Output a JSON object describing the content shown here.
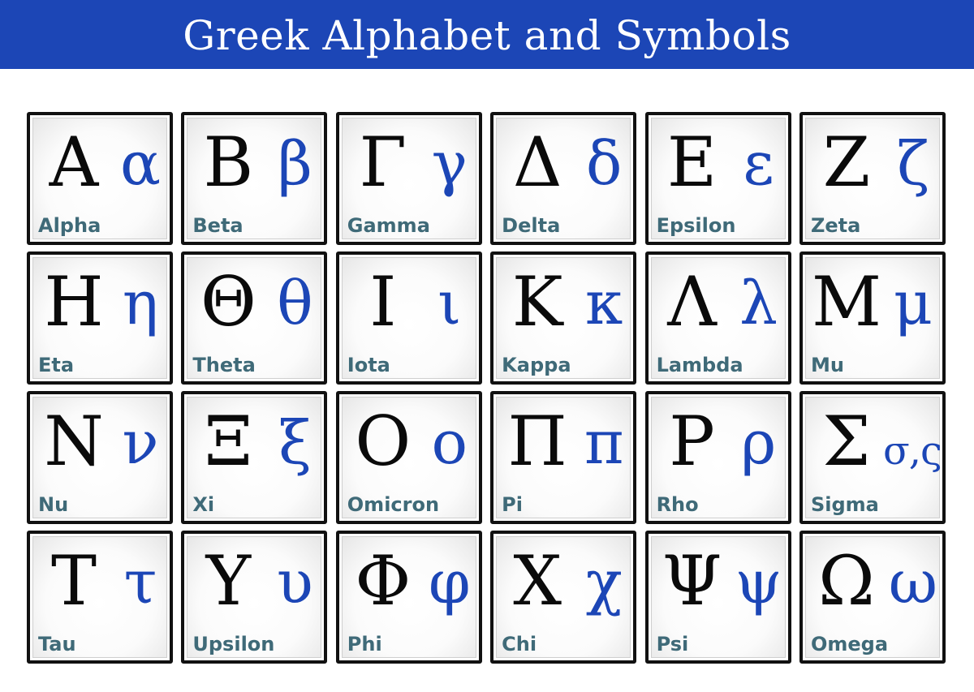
{
  "title": "Greek Alphabet and Symbols",
  "letters": [
    {
      "upper": "Α",
      "lower": "α",
      "name": "Alpha"
    },
    {
      "upper": "Β",
      "lower": "β",
      "name": "Beta"
    },
    {
      "upper": "Γ",
      "lower": "γ",
      "name": "Gamma"
    },
    {
      "upper": "Δ",
      "lower": "δ",
      "name": "Delta"
    },
    {
      "upper": "Ε",
      "lower": "ε",
      "name": "Epsilon"
    },
    {
      "upper": "Ζ",
      "lower": "ζ",
      "name": "Zeta"
    },
    {
      "upper": "Η",
      "lower": "η",
      "name": "Eta"
    },
    {
      "upper": "Θ",
      "lower": "θ",
      "name": "Theta"
    },
    {
      "upper": "Ι",
      "lower": "ι",
      "name": "Iota"
    },
    {
      "upper": "Κ",
      "lower": "κ",
      "name": "Kappa"
    },
    {
      "upper": "Λ",
      "lower": "λ",
      "name": "Lambda"
    },
    {
      "upper": "Μ",
      "lower": "μ",
      "name": "Mu"
    },
    {
      "upper": "Ν",
      "lower": "ν",
      "name": "Nu"
    },
    {
      "upper": "Ξ",
      "lower": "ξ",
      "name": "Xi"
    },
    {
      "upper": "Ο",
      "lower": "ο",
      "name": "Omicron"
    },
    {
      "upper": "Π",
      "lower": "π",
      "name": "Pi"
    },
    {
      "upper": "Ρ",
      "lower": "ρ",
      "name": "Rho"
    },
    {
      "upper": "Σ",
      "lower": "σ,ς",
      "name": "Sigma"
    },
    {
      "upper": "Τ",
      "lower": "τ",
      "name": "Tau"
    },
    {
      "upper": "Υ",
      "lower": "υ",
      "name": "Upsilon"
    },
    {
      "upper": "Φ",
      "lower": "φ",
      "name": "Phi"
    },
    {
      "upper": "Χ",
      "lower": "χ",
      "name": "Chi"
    },
    {
      "upper": "Ψ",
      "lower": "ψ",
      "name": "Psi"
    },
    {
      "upper": "Ω",
      "lower": "ω",
      "name": "Omega"
    }
  ],
  "colors": {
    "banner": "#1c46b6",
    "lowercase": "#1c46b6",
    "uppercase": "#0a0a0a",
    "name": "#3f6a78"
  }
}
